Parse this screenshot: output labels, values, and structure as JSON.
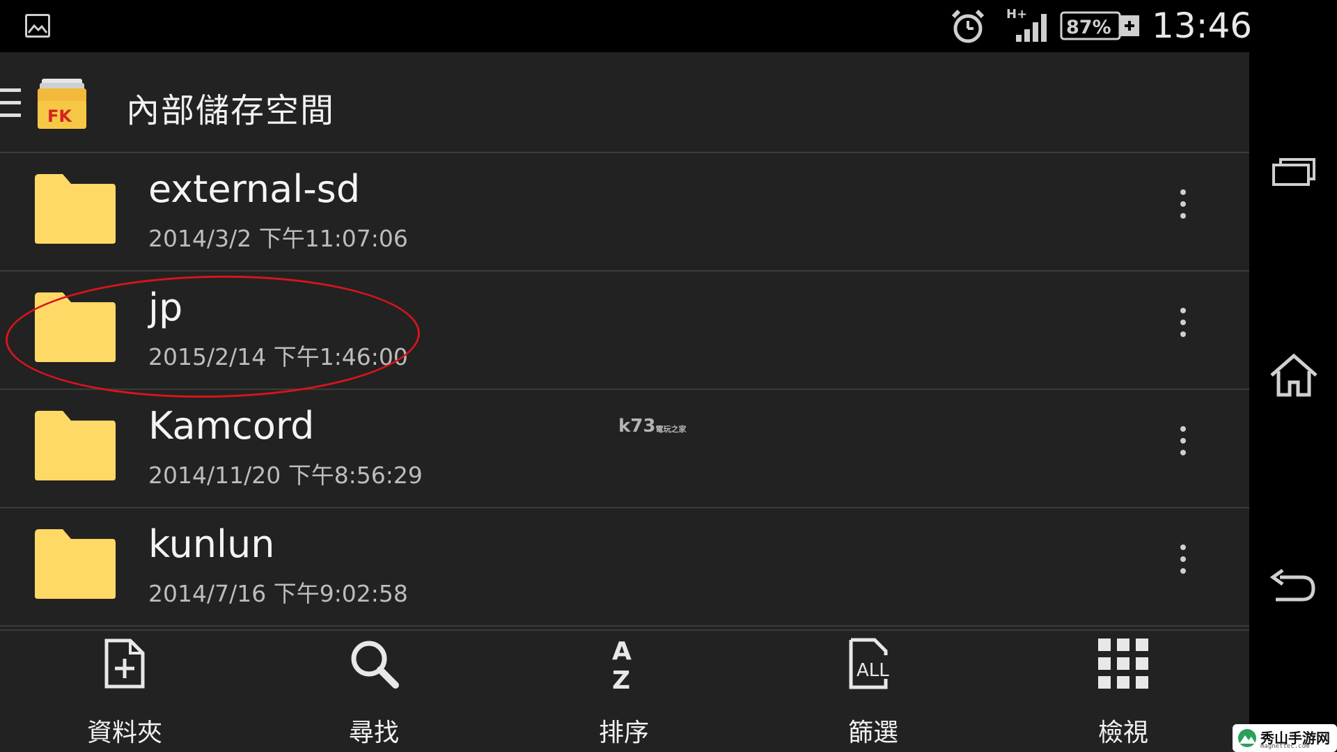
{
  "status_bar": {
    "network": "H+",
    "battery": "87%",
    "time": "13:46"
  },
  "toolbar": {
    "title": "內部儲存空間",
    "logo_text": "FK"
  },
  "files": [
    {
      "name": "external-sd",
      "date": "2014/3/2 下午11:07:06"
    },
    {
      "name": "jp",
      "date": "2015/2/14 下午1:46:00"
    },
    {
      "name": "Kamcord",
      "date": "2014/11/20 下午8:56:29"
    },
    {
      "name": "kunlun",
      "date": "2014/7/16 下午9:02:58"
    }
  ],
  "bottom_bar": {
    "new_folder": "資料夾",
    "search": "尋找",
    "sort": "排序",
    "sort_icon_top": "A",
    "sort_icon_bottom": "Z",
    "filter": "篩選",
    "filter_icon_text": "ALL",
    "view": "檢視"
  },
  "watermark": {
    "main": "k73",
    "sub": "電玩之家"
  },
  "corner_logo": {
    "title": "秀山手游网",
    "sub": "magnettec.com"
  },
  "colors": {
    "folder": "#FFD966",
    "background": "#222222",
    "highlight_circle": "#D8141C"
  }
}
